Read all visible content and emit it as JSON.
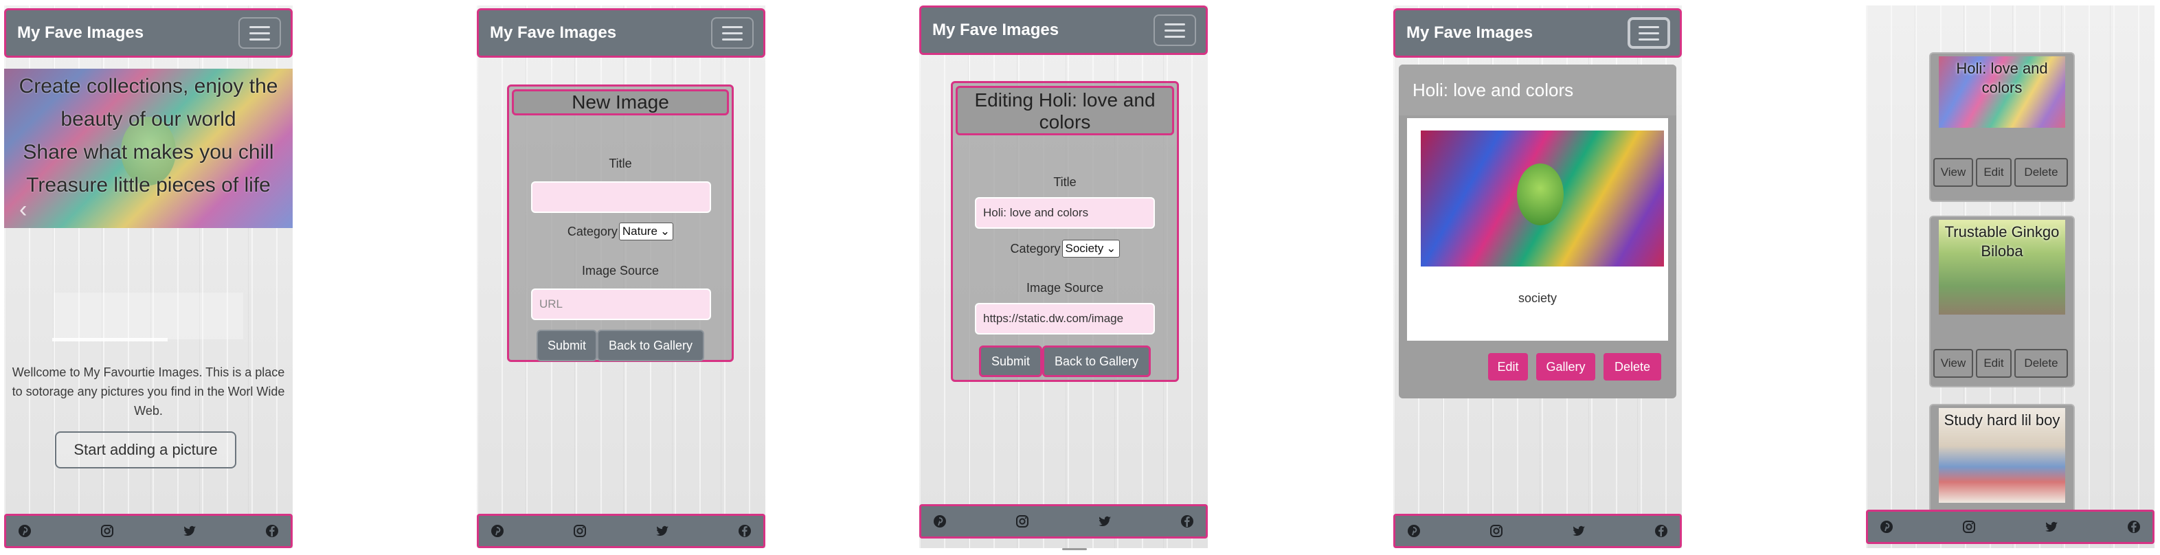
{
  "brand": "My Fave Images",
  "footer_icons": [
    "pinterest-icon",
    "instagram-icon",
    "twitter-icon",
    "facebook-icon"
  ],
  "colors": {
    "navbar": "#6c757d",
    "accent": "#d63384"
  },
  "home": {
    "hero_lines": [
      "Create collections, enjoy the",
      "beauty of our world",
      "Share what makes you chill",
      "Treasure little pieces of life"
    ],
    "welcome": "Wellcome to My Favourtie Images. This is a place to sotorage any pictures you find in the Worl Wide Web.",
    "start_button": "Start adding a picture"
  },
  "new_image": {
    "heading": "New Image",
    "title_label": "Title",
    "title_value": "",
    "category_label": "Category",
    "category_selected": "Nature",
    "source_label": "Image Source",
    "source_placeholder": "URL",
    "submit": "Submit",
    "back": "Back to Gallery"
  },
  "edit_image": {
    "heading_line1": "Editing Holi: love and",
    "heading_line2": "colors",
    "title_label": "Title",
    "title_value": "Holi: love and colors",
    "category_label": "Category",
    "category_selected": "Society",
    "source_label": "Image Source",
    "source_value": "https://static.dw.com/image",
    "submit": "Submit",
    "back": "Back to Gallery"
  },
  "detail": {
    "title": "Holi: love and colors",
    "category": "society",
    "edit": "Edit",
    "gallery": "Gallery",
    "delete": "Delete"
  },
  "gallery": {
    "items": [
      {
        "title": "Holi: love and colors"
      },
      {
        "title": "Trustable Ginkgo Biloba"
      },
      {
        "title": "Study hard lil boy"
      }
    ],
    "view": "View",
    "edit": "Edit",
    "delete": "Delete"
  }
}
